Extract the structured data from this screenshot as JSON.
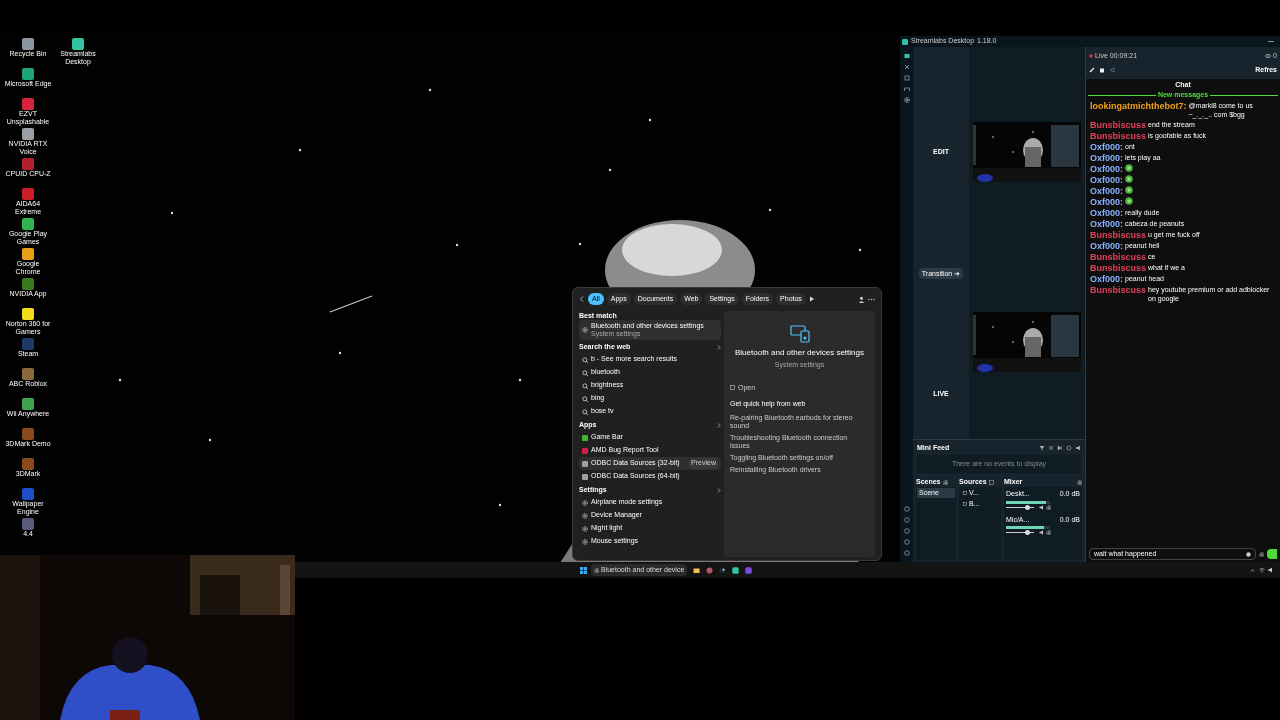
{
  "desktop": {
    "icons": [
      {
        "label": "Recycle Bin",
        "color": "#8a96a3"
      },
      {
        "label": "Microsoft Edge",
        "color": "#1fa37a"
      },
      {
        "label": "EZVT Unsplashable",
        "color": "#d8243a"
      },
      {
        "label": "NVIDIA RTX Voice",
        "color": "#9aa0a6"
      },
      {
        "label": "CPUID CPU-Z",
        "color": "#b21f2d"
      },
      {
        "label": "AIDA64 Extreme",
        "color": "#c81e28"
      },
      {
        "label": "Google Play Games",
        "color": "#2fb34a"
      },
      {
        "label": "Google Chrome",
        "color": "#e8a21a"
      },
      {
        "label": "NVIDIA App",
        "color": "#3c7a1e"
      },
      {
        "label": "Norton 360 for Gamers",
        "color": "#f2df1c"
      },
      {
        "label": "Steam",
        "color": "#1b3a66"
      },
      {
        "label": "ABC Roblox",
        "color": "#8a6a3c"
      },
      {
        "label": "Wii Anywhere",
        "color": "#3fa34d"
      },
      {
        "label": "3DMark Demo",
        "color": "#8a4a1e"
      },
      {
        "label": "3DMark",
        "color": "#8a4a1e"
      },
      {
        "label": "Wallpaper Engine",
        "color": "#1e4fc8"
      },
      {
        "label": "4.4",
        "color": "#5a5a7a"
      },
      {
        "label": "Streamlabs Desktop",
        "color": "#31c3a2"
      }
    ]
  },
  "search_panel": {
    "tabs": [
      {
        "label": "All",
        "selected": true
      },
      {
        "label": "Apps",
        "selected": false
      },
      {
        "label": "Documents",
        "selected": false
      },
      {
        "label": "Web",
        "selected": false
      },
      {
        "label": "Settings",
        "selected": false
      },
      {
        "label": "Folders",
        "selected": false
      },
      {
        "label": "Photos",
        "selected": false
      }
    ],
    "best_match": {
      "heading": "Best match",
      "title": "Bluetooth and other devices settings",
      "subtitle": "System settings",
      "selected": true
    },
    "sections": [
      {
        "heading": "Search the web",
        "items": [
          {
            "kind": "search",
            "label": "b - See more search results",
            "selected": false
          },
          {
            "kind": "search",
            "label": "bluetooth",
            "selected": false
          },
          {
            "kind": "search",
            "label": "brightness",
            "selected": false
          },
          {
            "kind": "search",
            "label": "bing",
            "selected": false
          },
          {
            "kind": "search",
            "label": "bose tv",
            "selected": false
          }
        ]
      },
      {
        "heading": "Apps",
        "items": [
          {
            "kind": "app",
            "label": "Game Bar",
            "color": "#3fb62a",
            "selected": false
          },
          {
            "kind": "app",
            "label": "AMD Bug Report Tool",
            "color": "#d2204a",
            "selected": false
          },
          {
            "kind": "app",
            "label": "ODBC Data Sources (32-bit)",
            "color": "#9aa0a6",
            "badge": "Preview",
            "selected": true
          },
          {
            "kind": "app",
            "label": "ODBC Data Sources (64-bit)",
            "color": "#9aa0a6",
            "selected": false
          }
        ]
      },
      {
        "heading": "Settings",
        "items": [
          {
            "kind": "setting",
            "label": "Airplane mode settings",
            "selected": false
          },
          {
            "kind": "setting",
            "label": "Device Manager",
            "selected": false
          },
          {
            "kind": "setting",
            "label": "Night light",
            "selected": false
          },
          {
            "kind": "setting",
            "label": "Mouse settings",
            "selected": false
          }
        ]
      }
    ],
    "detail": {
      "title": "Bluetooth and other devices settings",
      "subtitle": "System settings",
      "open": "Open",
      "help_heading": "Get quick help from web",
      "help_links": [
        "Re-pairing Bluetooth earbuds for stereo sound",
        "Troubleshooting Bluetooth connection issues",
        "Toggling Bluetooth settings on/off",
        "Reinstalling Bluetooth drivers"
      ]
    }
  },
  "streamlabs": {
    "title": "Streamlabs Desktop",
    "version": "1.18.0",
    "edit_label": "EDIT",
    "transition": "Transition ➜",
    "live_label": "LIVE",
    "mini_feed": {
      "title": "Mini Feed",
      "empty": "There are no events to display"
    },
    "scenes": {
      "title": "Scenes",
      "items": [
        {
          "name": "Scene",
          "selected": true
        }
      ]
    },
    "sources": {
      "title": "Sources",
      "items": [
        {
          "name": "V..."
        },
        {
          "name": "B..."
        }
      ]
    },
    "mixer": {
      "title": "Mixer",
      "channels": [
        {
          "name": "Deskt...",
          "reading": "0.0 dB",
          "meter": {
            "level": 0.92
          },
          "fader": {
            "level": 0.78
          }
        },
        {
          "name": "Mic/A...",
          "reading": "0.0 dB",
          "meter": {
            "level": 0.86
          },
          "fader": {
            "level": 0.78
          }
        }
      ]
    }
  },
  "chat": {
    "live": "Live 00:09:21",
    "viewers": "0",
    "refresh": "Refres",
    "title": "Chat",
    "new_messages": "New messages",
    "messages": [
      {
        "kind": "text",
        "user": "lookingatmichthebot7:",
        "color": "#f0a020",
        "text": "@marki8 come to us ~_._._.. com $bgg"
      },
      {
        "kind": "text",
        "user": "Bunsbiscuss",
        "color": "#e0405a",
        "text": "end the stream"
      },
      {
        "kind": "text",
        "user": "Bunsbiscuss",
        "color": "#e0405a",
        "text": "is goofable as fuck"
      },
      {
        "kind": "text",
        "user": "Oxf000:",
        "color": "#8ab4ff",
        "text": "ont"
      },
      {
        "kind": "text",
        "user": "Oxf000:",
        "color": "#8ab4ff",
        "text": "lets play aa"
      },
      {
        "kind": "emote",
        "user": "Oxf000:",
        "color": "#8ab4ff"
      },
      {
        "kind": "emote",
        "user": "Oxf000:",
        "color": "#8ab4ff"
      },
      {
        "kind": "emote",
        "user": "Oxf000:",
        "color": "#8ab4ff"
      },
      {
        "kind": "emote",
        "user": "Oxf000:",
        "color": "#8ab4ff"
      },
      {
        "kind": "text",
        "user": "Oxf000:",
        "color": "#8ab4ff",
        "text": "really dude"
      },
      {
        "kind": "text",
        "user": "Oxf000:",
        "color": "#8ab4ff",
        "text": "cabeza de peanuts"
      },
      {
        "kind": "text",
        "user": "Bunsbiscuss",
        "color": "#e0405a",
        "text": "u get me fuck off"
      },
      {
        "kind": "text",
        "user": "Oxf000:",
        "color": "#8ab4ff",
        "text": "peanut hell"
      },
      {
        "kind": "text",
        "user": "Bunsbiscuss",
        "color": "#e0405a",
        "text": "ce"
      },
      {
        "kind": "text",
        "user": "Bunsbiscuss",
        "color": "#e0405a",
        "text": "what if we a"
      },
      {
        "kind": "text",
        "user": "Oxf000:",
        "color": "#8ab4ff",
        "text": "peanut head"
      },
      {
        "kind": "text",
        "user": "Bunsbiscuss",
        "color": "#e0405a",
        "text": "hey youtube premium or add adblocker on google"
      }
    ],
    "input": "wait what happened"
  },
  "taskbar": {
    "search_button": "Bluetooth and other device"
  }
}
